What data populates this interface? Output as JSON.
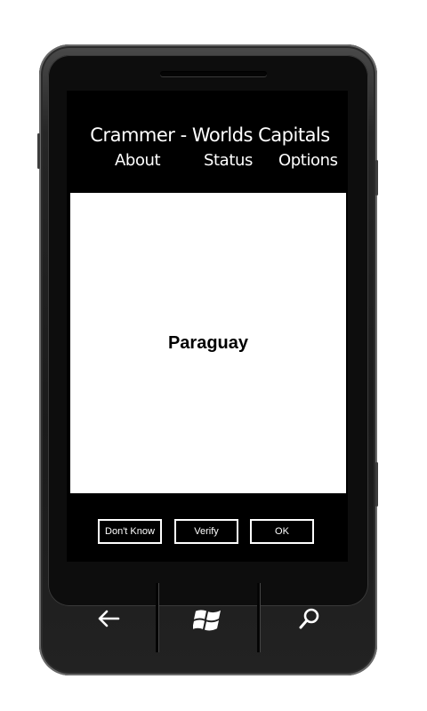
{
  "app": {
    "title": "Crammer - Worlds Capitals"
  },
  "nav": {
    "about": "About",
    "status": "Status",
    "options": "Options"
  },
  "card": {
    "country": "Paraguay"
  },
  "actions": {
    "dont_know": "Don't Know",
    "verify": "Verify",
    "ok": "OK"
  },
  "hardware_buttons": {
    "back_icon": "back-arrow-icon",
    "start_icon": "windows-logo-icon",
    "search_icon": "search-icon"
  },
  "colors": {
    "screen_background": "#000000",
    "card_background": "#ffffff",
    "text_light": "#ffffff",
    "text_dark": "#000000"
  }
}
